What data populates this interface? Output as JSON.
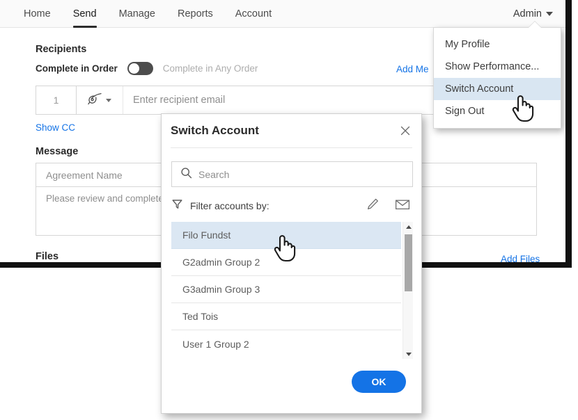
{
  "app": {
    "nav": {
      "items": [
        {
          "label": "Home",
          "active": false
        },
        {
          "label": "Send",
          "active": true
        },
        {
          "label": "Manage",
          "active": false
        },
        {
          "label": "Reports",
          "active": false
        },
        {
          "label": "Account",
          "active": false
        }
      ],
      "account_menu_label": "Admin"
    },
    "account_dropdown": {
      "items": [
        {
          "label": "My Profile",
          "highlighted": false
        },
        {
          "label": "Show Performance...",
          "highlighted": false
        },
        {
          "label": "Switch Account",
          "highlighted": true
        },
        {
          "label": "Sign Out",
          "highlighted": false
        }
      ]
    },
    "recipients": {
      "title": "Recipients",
      "order_on_label": "Complete in Order",
      "order_off_label": "Complete in Any Order",
      "toggle_state": "off",
      "add_me_label": "Add Me",
      "show_cc_label": "Show CC",
      "row": {
        "index": "1",
        "role_icon": "pen-nib-icon",
        "email_placeholder": "Enter recipient email"
      }
    },
    "message": {
      "title": "Message",
      "agreement_name_placeholder": "Agreement Name",
      "body_text": "Please review and complete t",
      "add_files_label": "Add Files"
    },
    "files": {
      "title": "Files"
    }
  },
  "modal": {
    "title": "Switch Account",
    "close_label": "×",
    "search": {
      "placeholder": "Search",
      "value": "",
      "icon": "search-icon"
    },
    "filter": {
      "label": "Filter accounts by:",
      "funnel_icon": "funnel-icon",
      "actions": [
        {
          "icon": "pencil-icon",
          "name": "filter-by-name"
        },
        {
          "icon": "envelope-icon",
          "name": "filter-by-email"
        }
      ]
    },
    "accounts": [
      {
        "label": "Filo Fundst",
        "selected": true
      },
      {
        "label": "G2admin Group 2",
        "selected": false
      },
      {
        "label": "G3admin Group 3",
        "selected": false
      },
      {
        "label": "Ted Tois",
        "selected": false
      },
      {
        "label": "User 1 Group 2",
        "selected": false
      }
    ],
    "ok_label": "OK"
  },
  "colors": {
    "accent_blue": "#1473e6",
    "selection_blue": "#dbe7f3",
    "menu_highlight": "#d9e6f2",
    "toggle_track": "#4d4d4d",
    "text_primary": "#2b2b2b",
    "text_muted": "#8e8e8e",
    "frame_black": "#111111"
  },
  "cursors": [
    {
      "name": "hand-cursor-menu",
      "target": "Switch Account"
    },
    {
      "name": "hand-cursor-list",
      "target": "Filo Fundst"
    }
  ]
}
